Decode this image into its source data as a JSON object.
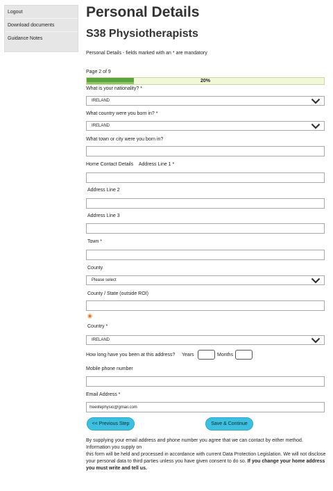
{
  "sidebar": {
    "items": [
      {
        "label": "Logout"
      },
      {
        "label": "Download documents"
      },
      {
        "label": "Guidance Notes"
      }
    ]
  },
  "header": {
    "title": "Personal Details",
    "subtitle": "S38 Physiotherapists",
    "intro": "Personal Details - fields marked with an * are mandatory"
  },
  "progress": {
    "page_text": "Page 2 of 9",
    "percent_label": "20%",
    "fraction": 0.2
  },
  "form": {
    "nationality": {
      "label": "What is your nationality? *",
      "value": "IRELAND"
    },
    "birth_country": {
      "label": "What country were you born in? *",
      "value": "IRELAND"
    },
    "birth_town": {
      "label": "What town or city were you born in?",
      "value": ""
    },
    "address_heading": "Home Contact Details",
    "address1": {
      "label": "Address Line 1 *",
      "value": ""
    },
    "address2": {
      "label": "Address Line 2",
      "value": ""
    },
    "address3": {
      "label": "Address Line 3",
      "value": ""
    },
    "town": {
      "label": "Town *",
      "value": ""
    },
    "county": {
      "label": "County",
      "value": "Please select"
    },
    "county_state": {
      "label": "County / State (outside ROI)",
      "value": ""
    },
    "country": {
      "label": "Country *",
      "value": "IRELAND"
    },
    "duration": {
      "label": "How long have you been at this address?",
      "years_label": "Years",
      "months_label": "Months"
    },
    "mobile": {
      "label": "Mobile phone number",
      "value": ""
    },
    "email": {
      "label": "Email Address *",
      "value": "freelifephysio@gmail.com"
    }
  },
  "buttons": {
    "previous": "<< Previous Step",
    "save": "Save & Continue"
  },
  "footer": {
    "line1": "By supplying your email address and phone number you agree that we can contact by either method.",
    "line2": "Information you supply on",
    "line3": "this form will be held and processed in accordance with current Data Protection Legislation. We will not disclose your personal data to third parties unless you have given consent to do so.",
    "bold": "If you change your home address you must write and tell us."
  },
  "colors": {
    "button_bg": "#3fbfe0",
    "progress_fill": "#5aa53a",
    "progress_track": "#f1f7d9",
    "sidebar_bg": "#e6e6e6"
  }
}
